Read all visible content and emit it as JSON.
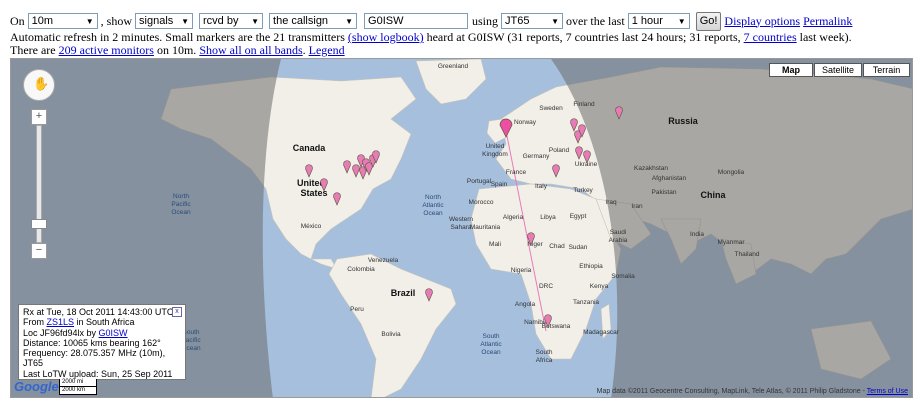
{
  "controls": {
    "on_label": "On",
    "band_value": "10m",
    "show_label": ", show",
    "what_value": "signals",
    "direction_value": "rcvd by",
    "target_value": "the callsign",
    "callsign_value": "G0ISW",
    "using_label": "using",
    "mode_value": "JT65",
    "over_label": "over the last",
    "period_value": "1 hour",
    "go_label": "Go!",
    "display_options": "Display options",
    "permalink": "Permalink"
  },
  "status": {
    "line2_prefix": "Automatic refresh in 2 minutes. Small markers are the 21 transmitters ",
    "show_logbook": "(show logbook)",
    "line2_middle": " heard at G0ISW (31 reports, 7 countries last 24 hours; 31 reports, ",
    "countries_link": "7 countries",
    "line2_suffix": " last week).",
    "line3_prefix": "There are ",
    "monitors_link": "209 active monitors",
    "line3_middle": " on 10m. ",
    "show_all_link": "Show all on all bands",
    "line3_sep": ". ",
    "legend_link": "Legend"
  },
  "map": {
    "type_buttons": [
      "Map",
      "Satellite",
      "Terrain"
    ],
    "labels": [
      {
        "t": "Greenland",
        "k": "sm"
      },
      {
        "t": "Canada",
        "k": "big"
      },
      {
        "t": "United",
        "k": "big"
      },
      {
        "t": "States",
        "k": "big"
      },
      {
        "t": "North",
        "k": "sea"
      },
      {
        "t": "Pacific",
        "k": "sea"
      },
      {
        "t": "Ocean",
        "k": "sea"
      },
      {
        "t": "North",
        "k": "sea"
      },
      {
        "t": "Atlantic",
        "k": "sea"
      },
      {
        "t": "Ocean",
        "k": "sea"
      },
      {
        "t": "México",
        "k": "sm"
      },
      {
        "t": "Venezuela",
        "k": "sm"
      },
      {
        "t": "Colombia",
        "k": "sm"
      },
      {
        "t": "Peru",
        "k": "sm"
      },
      {
        "t": "Brazil",
        "k": "big"
      },
      {
        "t": "Bolivia",
        "k": "sm"
      },
      {
        "t": "South",
        "k": "sea"
      },
      {
        "t": "Pacific",
        "k": "sea"
      },
      {
        "t": "Ocean",
        "k": "sea"
      },
      {
        "t": "South",
        "k": "sea"
      },
      {
        "t": "Atlantic",
        "k": "sea"
      },
      {
        "t": "Ocean",
        "k": "sea"
      },
      {
        "t": "Sweden",
        "k": "sm"
      },
      {
        "t": "Norway",
        "k": "sm"
      },
      {
        "t": "Finland",
        "k": "sm"
      },
      {
        "t": "United",
        "k": "sm"
      },
      {
        "t": "Kingdom",
        "k": "sm"
      },
      {
        "t": "Poland",
        "k": "sm"
      },
      {
        "t": "France",
        "k": "sm"
      },
      {
        "t": "Spain",
        "k": "sm"
      },
      {
        "t": "Ukraine",
        "k": "sm"
      },
      {
        "t": "Turkey",
        "k": "sm"
      },
      {
        "t": "Russia",
        "k": "big"
      },
      {
        "t": "Kazakhstan",
        "k": "sm"
      },
      {
        "t": "Mongolia",
        "k": "sm"
      },
      {
        "t": "China",
        "k": "big"
      },
      {
        "t": "Iran",
        "k": "sm"
      },
      {
        "t": "India",
        "k": "sm"
      },
      {
        "t": "Algeria",
        "k": "sm"
      },
      {
        "t": "Libya",
        "k": "sm"
      },
      {
        "t": "Egypt",
        "k": "sm"
      },
      {
        "t": "Mali",
        "k": "sm"
      },
      {
        "t": "Niger",
        "k": "sm"
      },
      {
        "t": "Chad",
        "k": "sm"
      },
      {
        "t": "Sudan",
        "k": "sm"
      },
      {
        "t": "Nigeria",
        "k": "sm"
      },
      {
        "t": "Ethiopia",
        "k": "sm"
      },
      {
        "t": "DRC",
        "k": "sm"
      },
      {
        "t": "Angola",
        "k": "sm"
      },
      {
        "t": "Kenya",
        "k": "sm"
      },
      {
        "t": "Tanzania",
        "k": "sm"
      },
      {
        "t": "Namibia",
        "k": "sm"
      },
      {
        "t": "Botswana",
        "k": "sm"
      },
      {
        "t": "South",
        "k": "sm"
      },
      {
        "t": "Africa",
        "k": "sm"
      },
      {
        "t": "Madagascar",
        "k": "sm"
      },
      {
        "t": "Saudi",
        "k": "sm"
      },
      {
        "t": "Arabia",
        "k": "sm"
      },
      {
        "t": "Pakistan",
        "k": "sm"
      },
      {
        "t": "Afghanistan",
        "k": "sm"
      },
      {
        "t": "Iraq",
        "k": "sm"
      },
      {
        "t": "Morocco",
        "k": "sm"
      },
      {
        "t": "Western",
        "k": "sm"
      },
      {
        "t": "Sahara",
        "k": "sm"
      },
      {
        "t": "Mauritania",
        "k": "sm"
      },
      {
        "t": "Somalia",
        "k": "sm"
      },
      {
        "t": "Myanmar",
        "k": "sm"
      },
      {
        "t": "Thailand",
        "k": "sm"
      },
      {
        "t": "Portugal",
        "k": "sm"
      },
      {
        "t": "Italy",
        "k": "sm"
      },
      {
        "t": "Germany",
        "k": "sm"
      }
    ],
    "infobox": {
      "line1": "Rx at Tue, 18 Oct 2011 14:43:00 UTC",
      "line2_prefix": "From ",
      "from_call": "ZS1LS",
      "line2_suffix": " in South Africa",
      "line3_prefix": "Loc JF96fd94lx by ",
      "by_call": "G0ISW",
      "line4": "Distance: 10065 kms bearing 162°",
      "line5": "Frequency: 28.075.357 MHz (10m), JT65",
      "line6": "Last LoTW upload: Sun, 25 Sep 2011",
      "close": "x"
    },
    "copyright": "Map data ©2011 Geocentre Consulting, MapLink, Tele Atlas, © 2011 Philip Gladstone - ",
    "terms": "Terms of Use",
    "google_logo": "Google",
    "scale_mi": "2000 mi",
    "scale_km": "2000 km",
    "colors": {
      "water": "#a5bfdd",
      "land": "#f2efe9",
      "night": "#7a7a7a",
      "marker": "#e87ab8",
      "receiver": "#ef4fa3"
    }
  }
}
